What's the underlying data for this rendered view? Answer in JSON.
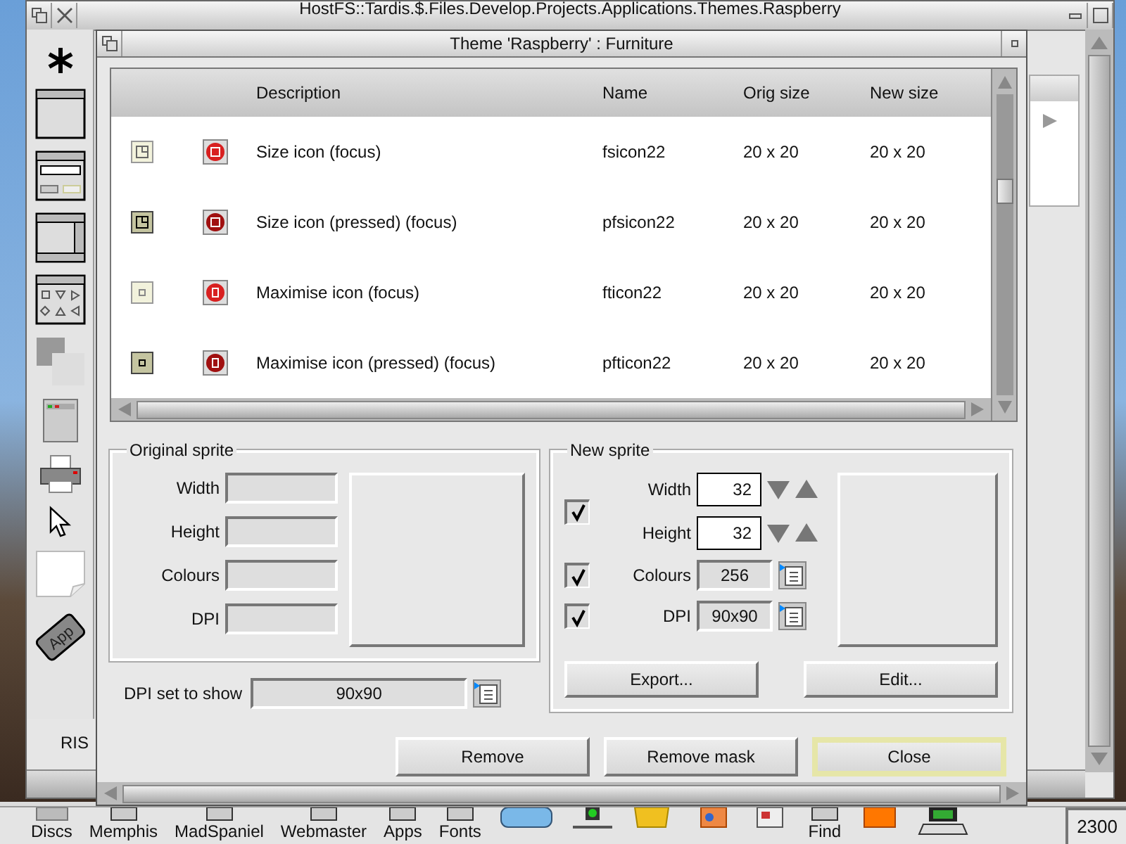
{
  "back_window": {
    "title": "HostFS::Tardis.$.Files.Develop.Projects.Applications.Themes.Raspberry",
    "status_text": "RIS"
  },
  "toolbox": {
    "app_label": "App"
  },
  "window": {
    "title": "Theme 'Raspberry' : Furniture"
  },
  "table": {
    "columns": [
      "Description",
      "Name",
      "Orig size",
      "New size"
    ],
    "rows": [
      {
        "kind": "size",
        "pressed": false,
        "description": "Size icon (focus)",
        "name": "fsicon22",
        "orig_size": "20 x 20",
        "new_size": "20 x 20"
      },
      {
        "kind": "size",
        "pressed": true,
        "description": "Size icon (pressed) (focus)",
        "name": "pfsicon22",
        "orig_size": "20 x 20",
        "new_size": "20 x 20"
      },
      {
        "kind": "maximise",
        "pressed": false,
        "description": "Maximise icon (focus)",
        "name": "fticon22",
        "orig_size": "20 x 20",
        "new_size": "20 x 20"
      },
      {
        "kind": "maximise",
        "pressed": true,
        "description": "Maximise icon (pressed) (focus)",
        "name": "pfticon22",
        "orig_size": "20 x 20",
        "new_size": "20 x 20"
      }
    ]
  },
  "original_sprite": {
    "title": "Original sprite",
    "fields": [
      "Width",
      "Height",
      "Colours",
      "DPI"
    ]
  },
  "dpi_show": {
    "label": "DPI set to show",
    "value": "90x90"
  },
  "new_sprite": {
    "title": "New sprite",
    "size": {
      "checked": true,
      "fields": [
        {
          "label": "Width",
          "value": "32"
        },
        {
          "label": "Height",
          "value": "32"
        }
      ]
    },
    "options": [
      {
        "label": "Colours",
        "value": "256",
        "checked": true
      },
      {
        "label": "DPI",
        "value": "90x90",
        "checked": true
      }
    ],
    "buttons": [
      "Export...",
      "Edit..."
    ]
  },
  "actions": [
    {
      "label": "Remove",
      "default": false
    },
    {
      "label": "Remove mask",
      "default": false
    },
    {
      "label": "Close",
      "default": true
    }
  ],
  "iconbar": [
    {
      "kind": "device",
      "label": "Discs"
    },
    {
      "kind": "app",
      "label": "Memphis"
    },
    {
      "kind": "app",
      "label": "MadSpaniel"
    },
    {
      "kind": "app",
      "label": "Webmaster"
    },
    {
      "kind": "app",
      "label": "Apps"
    },
    {
      "kind": "app",
      "label": "Fonts"
    },
    {
      "kind": "app",
      "label": "Find"
    },
    {
      "kind": "clock",
      "label": "2300"
    }
  ]
}
